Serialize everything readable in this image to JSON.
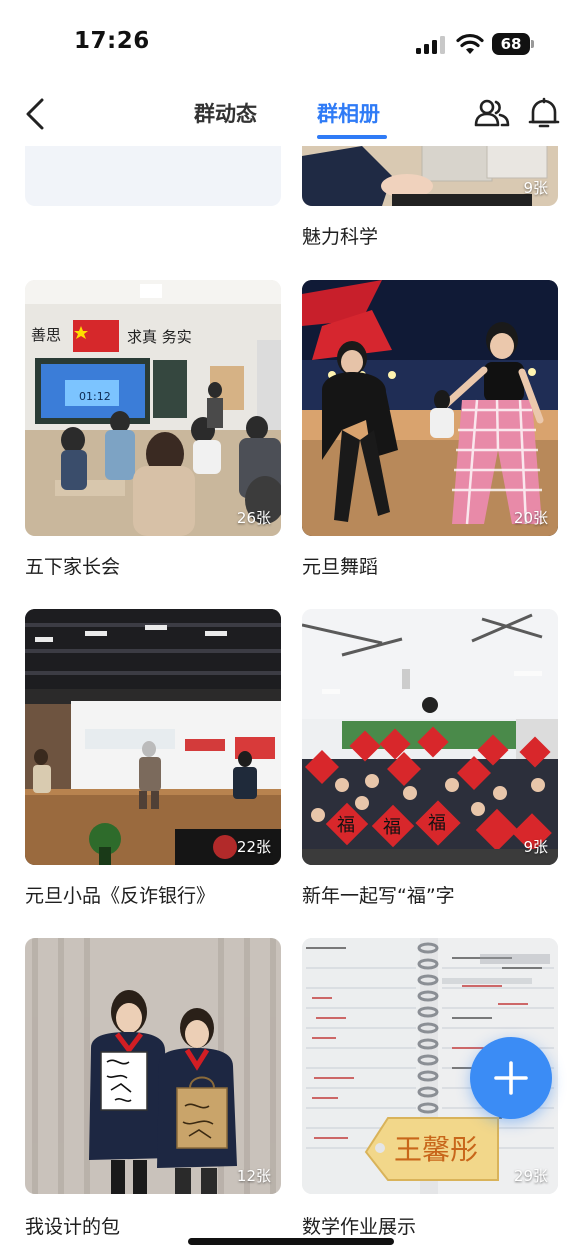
{
  "status_bar": {
    "time": "17:26",
    "battery": "68"
  },
  "nav": {
    "tabs": [
      {
        "label": "群动态",
        "active": false
      },
      {
        "label": "群相册",
        "active": true
      }
    ],
    "accent_color": "#2f7bf6"
  },
  "albums": [
    {
      "title": "",
      "count": ""
    },
    {
      "title": "魅力科学",
      "count": "9张"
    },
    {
      "title": "五下家长会",
      "count": "26张"
    },
    {
      "title": "元旦舞蹈",
      "count": "20张"
    },
    {
      "title": "元旦小品《反诈银行》",
      "count": "22张"
    },
    {
      "title": "新年一起写“福”字",
      "count": "9张"
    },
    {
      "title": "我设计的包",
      "count": "12张"
    },
    {
      "title": "数学作业展示",
      "count": "29张"
    }
  ],
  "overlay_texts": {
    "classroom_screen": "01:12",
    "name_tag": "王馨彤",
    "fu_char": "福"
  },
  "icons": [
    "back-icon",
    "members-icon",
    "bell-icon",
    "add-icon",
    "signal-icon",
    "wifi-icon"
  ]
}
